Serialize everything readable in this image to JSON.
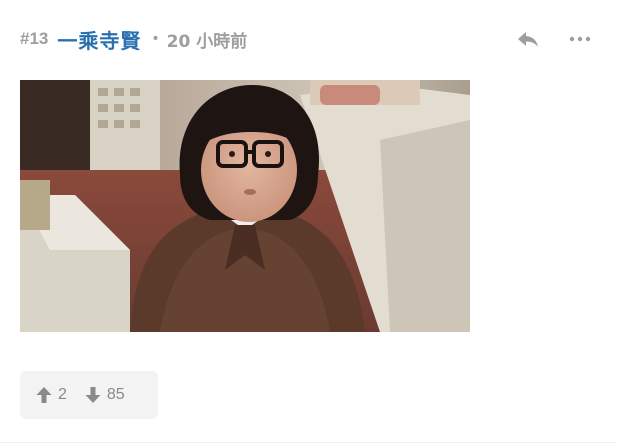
{
  "post": {
    "floor": "#13",
    "username": "一乘寺賢",
    "separator": "•",
    "time": "20 小時前"
  },
  "actions": {
    "reply_icon": "reply-icon",
    "more_icon": "more-dots-icon"
  },
  "votes": {
    "up_icon": "arrow-up-icon",
    "up_count": "2",
    "down_icon": "arrow-down-icon",
    "down_count": "85"
  },
  "colors": {
    "username": "#2a6fb0",
    "muted": "#9e9e9e",
    "vote_bg": "#f3f3f3"
  }
}
